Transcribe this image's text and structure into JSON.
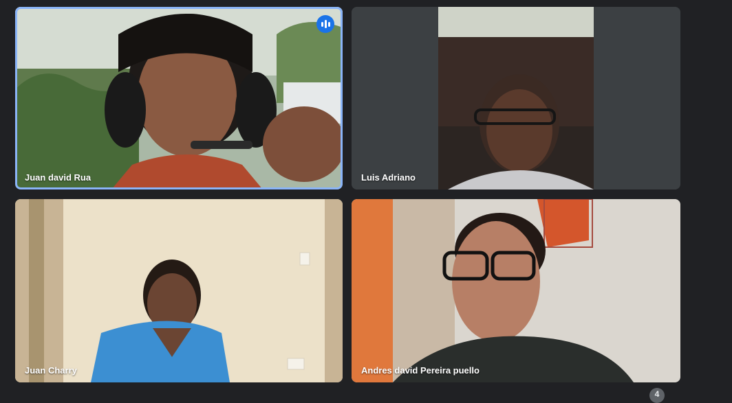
{
  "participants": [
    {
      "name": "Juan david Rua",
      "active_speaker": true
    },
    {
      "name": "Luis Adriano",
      "active_speaker": false
    },
    {
      "name": "Juan Charry",
      "active_speaker": false
    },
    {
      "name": "Andres david Pereira puello",
      "active_speaker": false
    }
  ],
  "hidden_participants_count": "4",
  "colors": {
    "background": "#202124",
    "tile": "#3c4043",
    "active_border": "#8ab4f8",
    "speaking_indicator": "#1a73e8"
  },
  "icons": {
    "speaking": "audio-level-icon"
  }
}
